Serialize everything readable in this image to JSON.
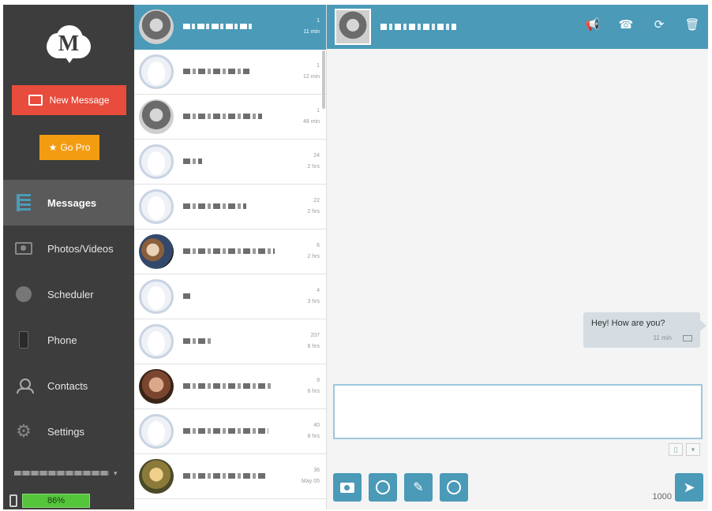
{
  "sidebar": {
    "logo_letter": "M",
    "new_message_label": "New Message",
    "go_pro_label": "Go Pro",
    "go_pro_star": "★",
    "nav": [
      {
        "label": "Messages",
        "icon": "messages-icon",
        "active": true
      },
      {
        "label": "Photos/Videos",
        "icon": "photos-icon",
        "active": false
      },
      {
        "label": "Scheduler",
        "icon": "scheduler-icon",
        "active": false
      },
      {
        "label": "Phone",
        "icon": "phone-icon",
        "active": false
      },
      {
        "label": "Contacts",
        "icon": "contacts-icon",
        "active": false
      },
      {
        "label": "Settings",
        "icon": "gear-icon",
        "active": false
      }
    ],
    "account_caret": "▾",
    "battery": "86%"
  },
  "conversations": [
    {
      "count": "1",
      "time": "11 min",
      "active": true
    },
    {
      "count": "1",
      "time": "12 min"
    },
    {
      "count": "1",
      "time": "48 min"
    },
    {
      "count": "24",
      "time": "2 hrs"
    },
    {
      "count": "22",
      "time": "2 hrs"
    },
    {
      "count": "6",
      "time": "2 hrs"
    },
    {
      "count": "4",
      "time": "3 hrs"
    },
    {
      "count": "207",
      "time": "6 hrs"
    },
    {
      "count": "9",
      "time": "6 hrs"
    },
    {
      "count": "40",
      "time": "8 hrs"
    },
    {
      "count": "36",
      "time": "May 05"
    }
  ],
  "chat": {
    "header_actions": [
      "megaphone-icon",
      "phone-icon",
      "refresh-icon",
      "trash-icon"
    ],
    "message": {
      "text": "Hey! How are you?",
      "time": "11 min"
    },
    "compose_placeholder": "",
    "char_count": "1000",
    "tools": [
      "camera-icon",
      "emoji-icon",
      "wand-icon",
      "clock-icon"
    ]
  },
  "colors": {
    "accent": "#4a9ab8",
    "new_message": "#e74c3c",
    "go_pro": "#f39c12",
    "sidebar": "#3d3d3d",
    "battery": "#55c53b"
  }
}
